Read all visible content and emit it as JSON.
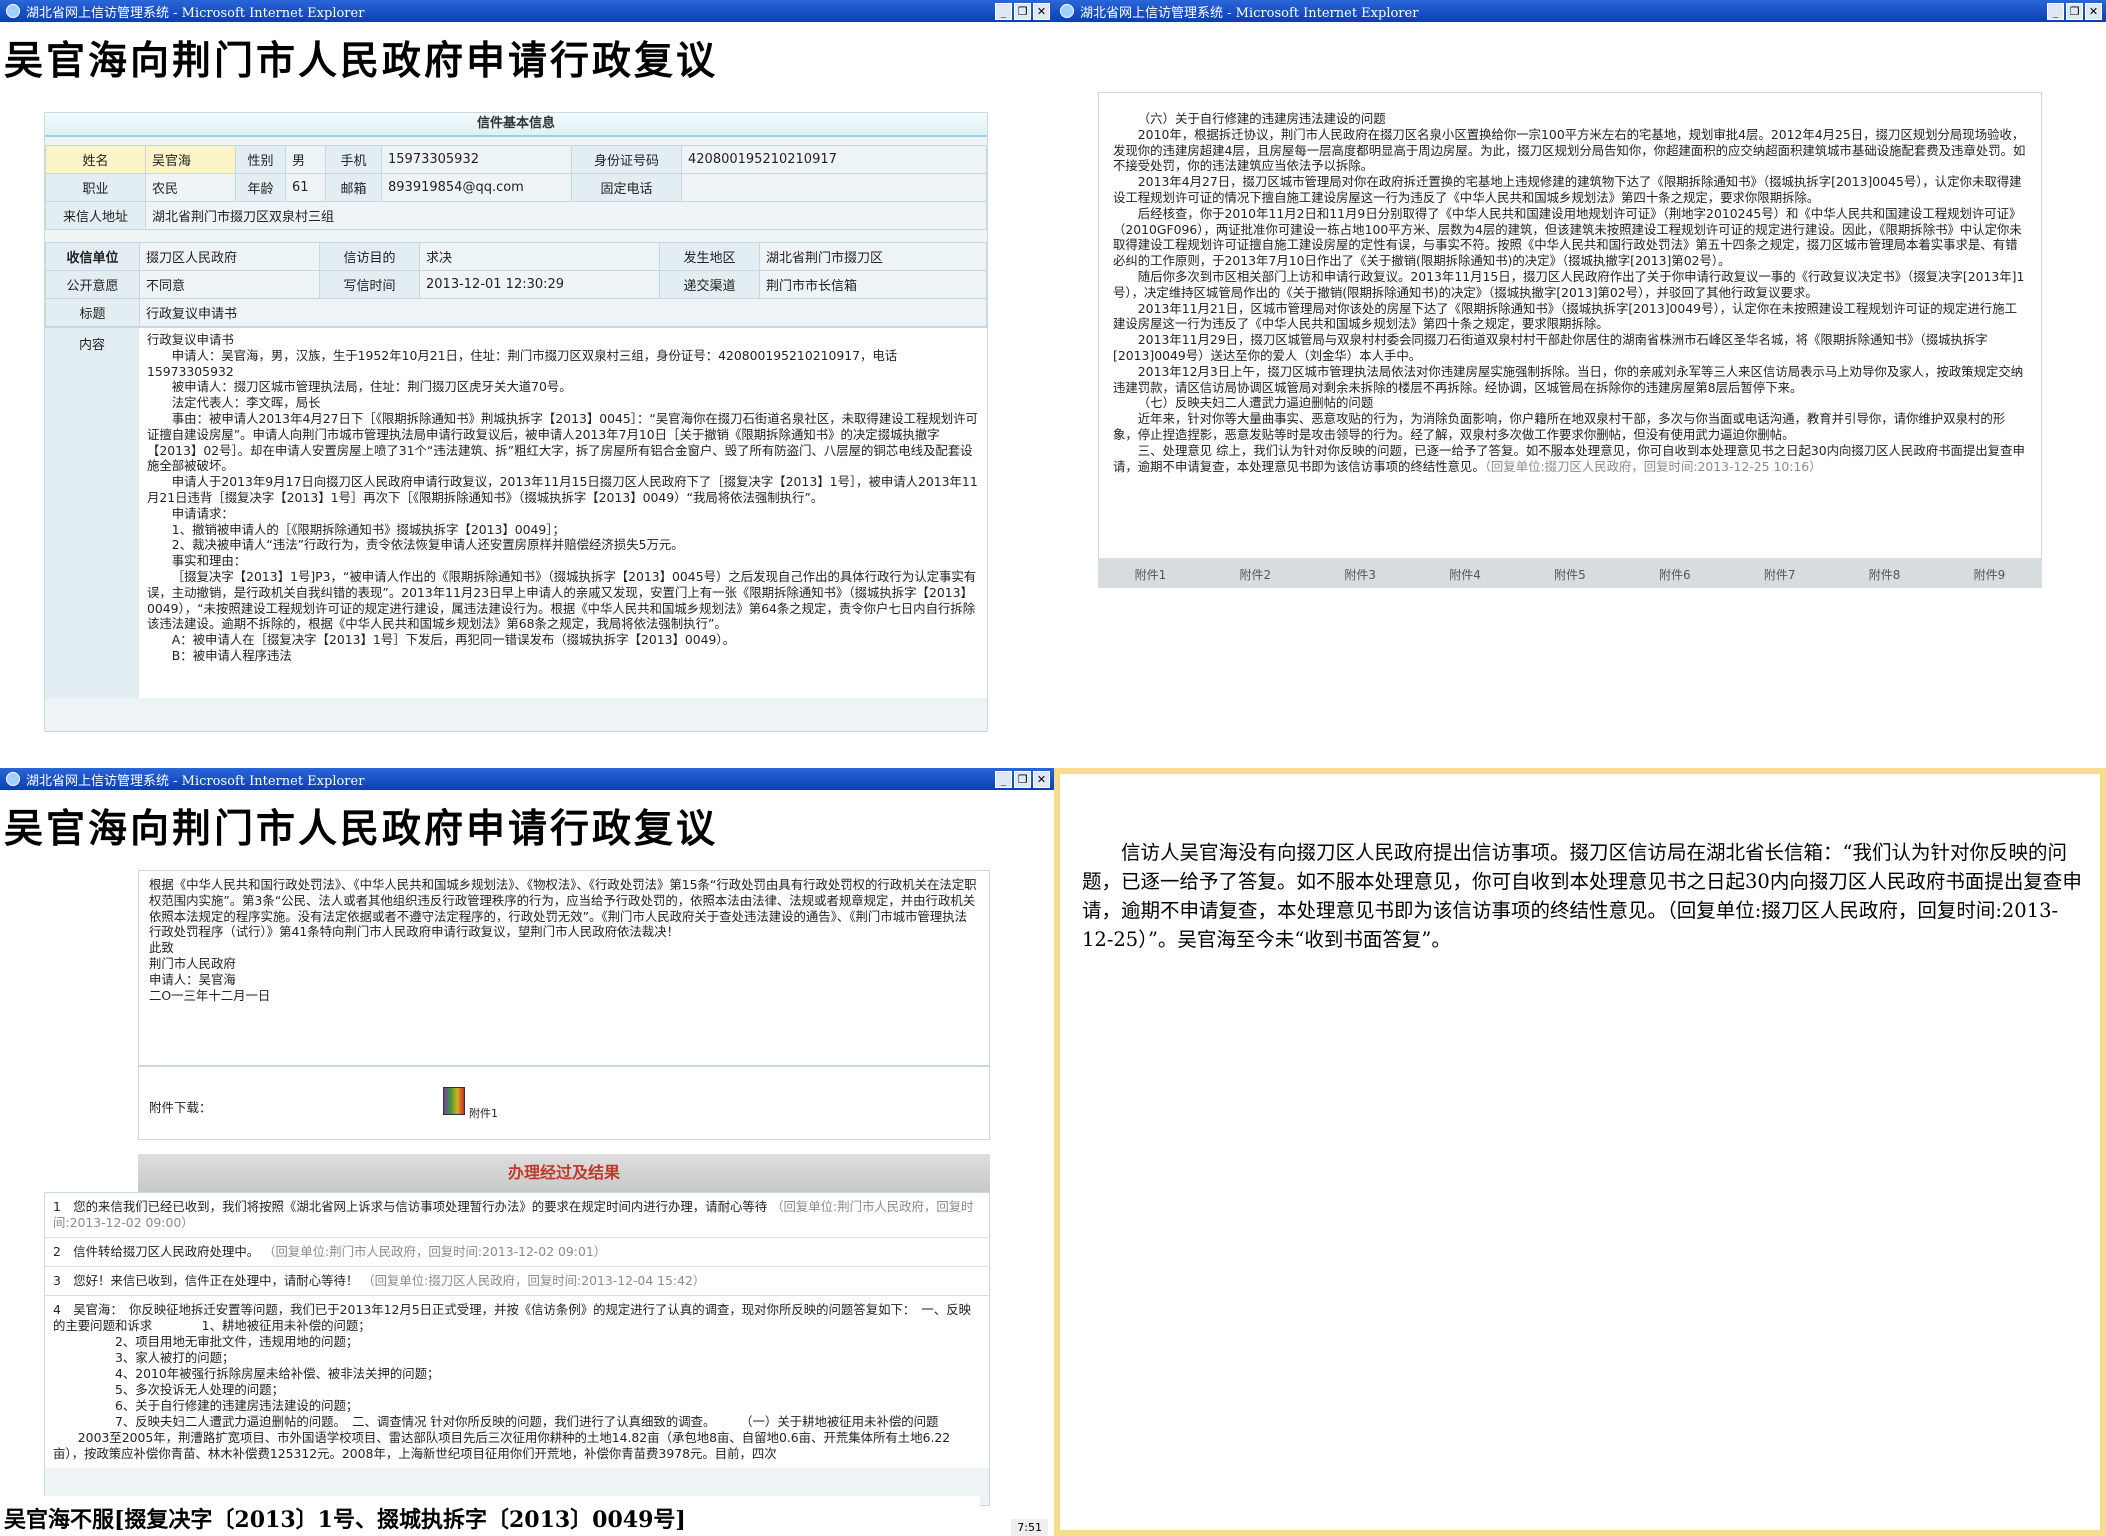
{
  "window_title": "湖北省网上信访管理系统 - Microsoft Internet Explorer",
  "banner_title": "吴官海向荆门市人民政府申请行政复议",
  "info": {
    "header": "信件基本信息",
    "name_label": "姓名",
    "name": "吴官海",
    "gender_label": "性别",
    "gender": "男",
    "phone_label": "手机",
    "phone": "15973305932",
    "id_label": "身份证号码",
    "id": "420800195210210917",
    "job_label": "职业",
    "job": "农民",
    "age_label": "年龄",
    "age": "61",
    "email_label": "邮箱",
    "email": "893919854@qq.com",
    "tel_label": "固定电话",
    "tel": "",
    "addr_label": "来信人地址",
    "addr": "湖北省荆门市掇刀区双泉村三组",
    "unit_label": "收信单位",
    "unit": "掇刀区人民政府",
    "purpose_label": "信访目的",
    "purpose": "求决",
    "region_label": "发生地区",
    "region": "湖北省荆门市掇刀区",
    "public_label": "公开意愿",
    "public": "不同意",
    "time_label": "写信时间",
    "time": "2013-12-01 12:30:29",
    "channel_label": "递交渠道",
    "channel": "荆门市市长信箱",
    "subject_label": "标题",
    "subject": "行政复议申请书",
    "content_label": "内容"
  },
  "content_lines": [
    "行政复议申请书",
    "申请人：吴官海，男，汉族，生于1952年10月21日，住址：荆门市掇刀区双泉村三组，身份证号：420800195210210917，电话15973305932",
    "被申请人：掇刀区城市管理执法局，住址：荆门掇刀区虎牙关大道70号。",
    "法定代表人：李文晖，局长",
    "事由：被申请人2013年4月27日下［《限期拆除通知书》荆城执拆字【2013】0045］：“吴官海你在掇刀石街道名泉社区，未取得建设工程规划许可证擅自建设房屋”。申请人向荆门市城市管理执法局申请行政复议后，被申请人2013年7月10日［关于撤销《限期拆除通知书》的决定掇城执撤字【2013】02号］。却在申请人安置房屋上喷了31个“违法建筑、拆”粗红大字，拆了房屋所有铝合金窗户、毁了所有防盗门、八层屋的铜芯电线及配套设施全部被破坏。",
    "申请人于2013年9月17日向掇刀区人民政府申请行政复议，2013年11月15日掇刀区人民政府下了［掇复决字【2013】1号］，被申请人2013年11月21日违背［掇复决字【2013】1号］再次下［《限期拆除通知书》（掇城执拆字【2013】0049）“我局将依法强制执行”。",
    "申请请求：",
    "1、撤销被申请人的［《限期拆除通知书》掇城执拆字【2013】0049］；",
    "2、裁决被申请人“违法”行政行为，责令依法恢复申请人还安置房原样并赔偿经济损失5万元。",
    "事实和理由：",
    "［掇复决字【2013】1号]P3，“被申请人作出的《限期拆除通知书》（掇城执拆字【2013】0045号）之后发现自己作出的具体行政行为认定事实有误，主动撤销，是行政机关自我纠错的表现”。2013年11月23日早上申请人的亲戚又发现，安置门上有一张《限期拆除通知书》（掇城执拆字【2013】0049），“未按照建设工程规划许可证的规定进行建设，属违法建设行为。根据《中华人民共和国城乡规划法》第64条之规定，责令你户七日内自行拆除该违法建设。逾期不拆除的，根据《中华人民共和国城乡规划法》第68条之规定，我局将依法强制执行”。",
    "A：被申请人在［掇复决字【2013】1号］下发后，再犯同一错误发布（掇城执拆字【2013】0049）。",
    "B：被申请人程序违法"
  ],
  "reply_lines": [
    "（六）关于自行修建的违建房违法建设的问题",
    "2010年，根据拆迁协议，荆门市人民政府在掇刀区名泉小区置换给你一宗100平方米左右的宅基地，规划审批4层。2012年4月25日，掇刀区规划分局现场验收，发现你的违建房超建4层，且房屋每一层高度都明显高于周边房屋。为此，掇刀区规划分局告知你，你超建面积的应交纳超面积建筑城市基础设施配套费及违章处罚。如不接受处罚，你的违法建筑应当依法予以拆除。",
    "2013年4月27日，掇刀区城市管理局对你在政府拆迁置换的宅基地上违规修建的建筑物下达了《限期拆除通知书》（掇城执拆字[2013]0045号），认定你未取得建设工程规划许可证的情况下擅自施工建设房屋这一行为违反了《中华人民共和国城乡规划法》第四十条之规定，要求你限期拆除。",
    "后经核查，你于2010年11月2日和11月9日分别取得了《中华人民共和国建设用地规划许可证》（荆地字2010245号）和《中华人民共和国建设工程规划许可证》（2010GF096），两证批准你可建设一栋占地100平方米、层数为4层的建筑，但该建筑未按照建设工程规划许可证的规定进行建设。因此，《限期拆除书》中认定你未取得建设工程规划许可证擅自施工建设房屋的定性有误，与事实不符。按照《中华人民共和国行政处罚法》第五十四条之规定，掇刀区城市管理局本着实事求是、有错必纠的工作原则，于2013年7月10日作出了《关于撤销(限期拆除通知书)的决定》（掇城执撤字[2013]第02号）。",
    "随后你多次到市区相关部门上访和申请行政复议。2013年11月15日，掇刀区人民政府作出了关于你申请行政复议一事的《行政复议决定书》（掇复决字[2013年]1号），决定维持区城管局作出的《关于撤销(限期拆除通知书)的决定》（掇城执撤字[2013]第02号），并驳回了其他行政复议要求。",
    "2013年11月21日，区城市管理局对你该处的房屋下达了《限期拆除通知书》（掇城执拆字[2013]0049号），认定你在未按照建设工程规划许可证的规定进行施工建设房屋这一行为违反了《中华人民共和国城乡规划法》第四十条之规定，要求限期拆除。",
    "2013年11月29日，掇刀区城管局与双泉村村委会同掇刀石街道双泉村村干部赴你居住的湖南省株洲市石峰区圣华名城，将《限期拆除通知书》（掇城执拆字[2013]0049号）送达至你的爱人（刘金华）本人手中。",
    "2013年12月3日上午，掇刀区城市管理执法局依法对你违建房屋实施强制拆除。当日，你的亲戚刘永军等三人来区信访局表示马上劝导你及家人，按政策规定交纳违建罚款，请区信访局协调区城管局对剩余未拆除的楼层不再拆除。经协调，区城管局在拆除你的违建房屋第8层后暂停下来。",
    "（七）反映夫妇二人遭武力逼迫删帖的问题",
    "近年来，针对你等大量曲事实、恶意攻贴的行为，为消除负面影响，你户籍所在地双泉村干部，多次与你当面或电话沟通，教育并引导你，请你维护双泉村的形象，停止捏造捏影，恶意发贴等时是攻击领导的行为。经了解，双泉村多次做工作要求你删帖，但没有使用武力逼迫你删帖。",
    "三、处理意见 综上，我们认为针对你反映的问题，已逐一给予了答复。如不服本处理意见，你可自收到本处理意见书之日起30内向掇刀区人民政府书面提出复查申请，逾期不申请复查，本处理意见书即为该信访事项的终结性意见。"
  ],
  "reply_meta": "（回复单位:掇刀区人民政府，回复时间:2013-12-25 10:16）",
  "attachments": [
    "附件1",
    "附件2",
    "附件3",
    "附件4",
    "附件5",
    "附件6",
    "附件7",
    "附件8",
    "附件9"
  ],
  "q3": {
    "law_lines": [
      "根据《中华人民共和国行政处罚法》、《中华人民共和国城乡规划法》、《物权法》、《行政处罚法》第15条“行政处罚由具有行政处罚权的行政机关在法定职权范围内实施”。第3条“公民、法人或者其他组织违反行政管理秩序的行为，应当给予行政处罚的，依照本法由法律、法规或者规章规定，并由行政机关依照本法规定的程序实施。没有法定依据或者不遵守法定程序的，行政处罚无效”。《荆门市人民政府关于查处违法建设的通告》、《荆门市城市管理执法行政处罚程序（试行）》第41条特向荆门市人民政府申请行政复议，望荆门市人民政府依法裁决！",
      "此致",
      "荆门市人民政府",
      "",
      "申请人：吴官海",
      "二O一三年十二月一日"
    ],
    "attach_label": "附件下载：",
    "attach_file": "附件1",
    "result_header": "办理经过及结果",
    "results": [
      {
        "no": "1",
        "text": "您的来信我们已经已收到，我们将按照《湖北省网上诉求与信访事项处理暂行办法》的要求在规定时间内进行办理，请耐心等待",
        "meta": "（回复单位:荆门市人民政府，回复时间:2013-12-02 09:00）"
      },
      {
        "no": "2",
        "text": "信件转给掇刀区人民政府处理中。",
        "meta": "（回复单位:荆门市人民政府，回复时间:2013-12-02 09:01）"
      },
      {
        "no": "3",
        "text": "您好！来信已收到，信件正在处理中，请耐心等待！",
        "meta": "（回复单位:掇刀区人民政府，回复时间:2013-12-04 15:42）"
      }
    ],
    "item4_lines": [
      "吴官海：　你反映征地拆迁安置等问题，我们已于2013年12月5日正式受理，并按《信访条例》的规定进行了认真的调查，现对你所反映的问题答复如下：　一、反映的主要问题和诉求　　　　1、耕地被征用未补偿的问题；",
      "2、项目用地无审批文件，违规用地的问题；",
      "3、家人被打的问题；",
      "4、2010年被强行拆除房屋未给补偿、被非法关押的问题；",
      "5、多次投诉无人处理的问题；",
      "6、关于自行修建的违建房违法建设的问题；",
      "7、反映夫妇二人遭武力逼迫删帖的问题。　二、调查情况 针对你所反映的问题，我们进行了认真细致的调查。　　　（一）关于耕地被征用未补偿的问题",
      "2003至2005年，荆漕路扩宽项目、市外国语学校项目、雷达部队项目先后三次征用你耕种的土地14.82亩（承包地8亩、自留地0.6亩、开荒集体所有土地6.22亩），按政策应补偿你青苗、林木补偿费125312元。2008年，上海新世纪项目征用你们开荒地，补偿你青苗费3978元。目前，四次"
    ],
    "item4_no": "4",
    "caption": "吴官海不服[掇复决字〔2013〕1号、掇城执拆字〔2013〕0049号]",
    "clock": "7:51"
  },
  "q4_text": "信访人吴官海没有向掇刀区人民政府提出信访事项。掇刀区信访局在湖北省长信箱：“我们认为针对你反映的问题，已逐一给予了答复。如不服本处理意见，你可自收到本处理意见书之日起30内向掇刀区人民政府书面提出复查申请，逾期不申请复查，本处理意见书即为该信访事项的终结性意见。（回复单位:掇刀区人民政府，回复时间:2013-12-25）”。吴官海至今未“收到书面答复”。",
  "colors": {
    "titlebar": "#0b3fb3",
    "frame_bg": "#eef4f6",
    "result_header": "#c0392b",
    "q4_border": "#f6dc8c"
  }
}
